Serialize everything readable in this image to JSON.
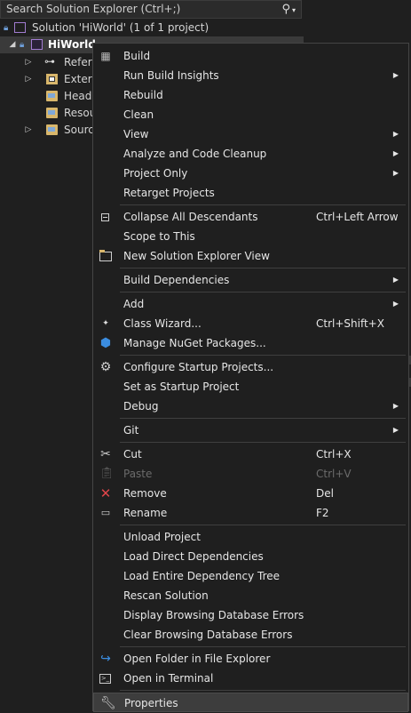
{
  "explorer": {
    "search_placeholder": "Search Solution Explorer (Ctrl+;)",
    "search_icon": "search-icon",
    "solution_label": "Solution 'HiWorld'  (1 of 1 project)",
    "project_label": "HiWorld",
    "nodes": [
      {
        "label": "References",
        "display": "Refere",
        "icon": "references-icon"
      },
      {
        "label": "External Dependencies",
        "display": "Extern",
        "icon": "external-dependencies-icon"
      },
      {
        "label": "Header Files",
        "display": "Heade",
        "icon": "filter-folder-icon"
      },
      {
        "label": "Resource Files",
        "display": "Resou",
        "icon": "filter-folder-icon"
      },
      {
        "label": "Source Files",
        "display": "Source",
        "icon": "filter-folder-icon"
      }
    ]
  },
  "menu": {
    "items": [
      {
        "label": "Build",
        "icon": "build-icon"
      },
      {
        "label": "Run Build Insights",
        "submenu": true
      },
      {
        "label": "Rebuild"
      },
      {
        "label": "Clean"
      },
      {
        "label": "View",
        "submenu": true
      },
      {
        "label": "Analyze and Code Cleanup",
        "submenu": true
      },
      {
        "label": "Project Only",
        "submenu": true
      },
      {
        "label": "Retarget Projects"
      },
      {
        "label": "Collapse All Descendants",
        "shortcut": "Ctrl+Left Arrow",
        "icon": "collapse-icon"
      },
      {
        "label": "Scope to This"
      },
      {
        "label": "New Solution Explorer View",
        "icon": "new-view-icon"
      },
      {
        "label": "Build Dependencies",
        "submenu": true
      },
      {
        "label": "Add",
        "submenu": true
      },
      {
        "label": "Class Wizard...",
        "shortcut": "Ctrl+Shift+X",
        "icon": "class-wizard-icon"
      },
      {
        "label": "Manage NuGet Packages...",
        "icon": "nuget-icon"
      },
      {
        "label": "Configure Startup Projects...",
        "icon": "gear-icon"
      },
      {
        "label": "Set as Startup Project"
      },
      {
        "label": "Debug",
        "submenu": true
      },
      {
        "label": "Git",
        "submenu": true
      },
      {
        "label": "Cut",
        "shortcut": "Ctrl+X",
        "icon": "cut-icon"
      },
      {
        "label": "Paste",
        "shortcut": "Ctrl+V",
        "icon": "paste-icon",
        "disabled": true
      },
      {
        "label": "Remove",
        "shortcut": "Del",
        "icon": "remove-icon"
      },
      {
        "label": "Rename",
        "shortcut": "F2",
        "icon": "rename-icon"
      },
      {
        "label": "Unload Project"
      },
      {
        "label": "Load Direct Dependencies"
      },
      {
        "label": "Load Entire Dependency Tree"
      },
      {
        "label": "Rescan Solution"
      },
      {
        "label": "Display Browsing Database Errors"
      },
      {
        "label": "Clear Browsing Database Errors"
      },
      {
        "label": "Open Folder in File Explorer",
        "icon": "open-folder-icon"
      },
      {
        "label": "Open in Terminal",
        "icon": "terminal-icon"
      },
      {
        "label": "Properties",
        "icon": "wrench-icon",
        "highlighted": true
      }
    ]
  },
  "colors": {
    "background": "#1f1f1f",
    "menu_border": "#454545",
    "highlight": "#3d3d3d",
    "text": "#e6e6e6",
    "disabled_text": "#6b6b6b",
    "remove_icon": "#e0454a",
    "accent_blue": "#3b8de0"
  }
}
